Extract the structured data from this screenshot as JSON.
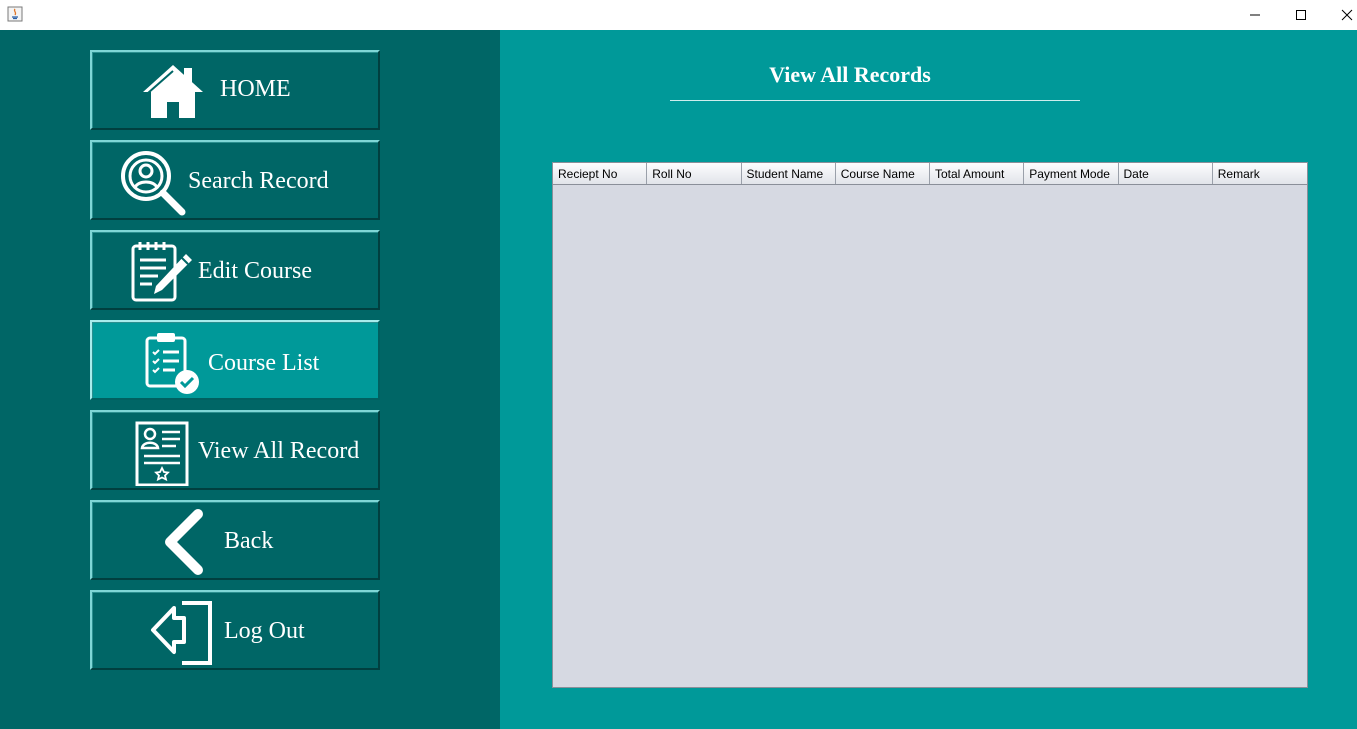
{
  "window": {
    "controls": {
      "minimize_icon": "minimize-icon",
      "maximize_icon": "maximize-icon",
      "close_icon": "close-icon"
    }
  },
  "sidebar": {
    "items": [
      {
        "label": "HOME",
        "icon": "home-icon"
      },
      {
        "label": "Search Record",
        "icon": "search-user-icon"
      },
      {
        "label": "Edit Course",
        "icon": "edit-notepad-icon"
      },
      {
        "label": "Course List",
        "icon": "checklist-clipboard-icon",
        "active": true
      },
      {
        "label": "View All Record",
        "icon": "certificate-icon"
      },
      {
        "label": "Back",
        "icon": "chevron-left-icon"
      },
      {
        "label": "Log Out",
        "icon": "logout-icon"
      }
    ]
  },
  "main": {
    "title": "View All Records",
    "table": {
      "columns": [
        "Reciept No",
        "Roll No",
        "Student Name",
        "Course Name",
        "Total Amount",
        "Payment Mode",
        "Date",
        "Remark"
      ],
      "rows": []
    }
  },
  "colors": {
    "sidebar_bg": "#006666",
    "main_bg": "#009999",
    "active_button_bg": "#009999",
    "table_bg": "#d6d9e2"
  }
}
